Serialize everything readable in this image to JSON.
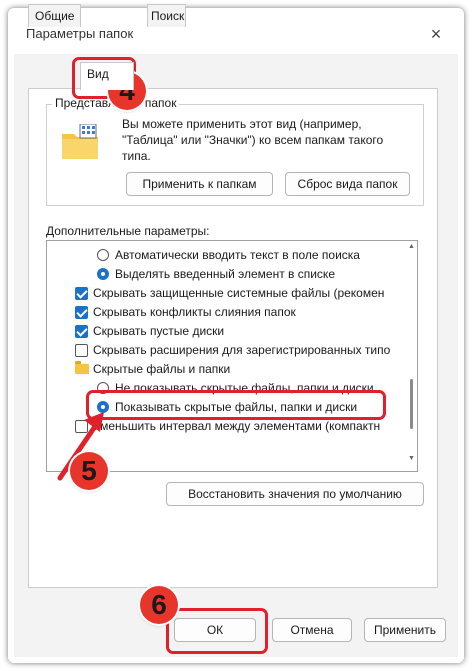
{
  "dialog": {
    "title": "Параметры папок",
    "close_label": "×"
  },
  "tabs": [
    {
      "label": "Общие"
    },
    {
      "label": "Вид"
    },
    {
      "label": "Поиск"
    }
  ],
  "folder_views": {
    "legend": "Представление папок",
    "description": "Вы можете применить этот вид (например, \"Таблица\" или \"Значки\") ко всем папкам такого типа.",
    "apply_button": "Применить к папкам",
    "reset_button": "Сброс вида папок"
  },
  "advanced": {
    "label": "Дополнительные параметры:",
    "items": [
      {
        "type": "radio",
        "checked": false,
        "indent": 1,
        "label": "Автоматически вводить текст в поле поиска"
      },
      {
        "type": "radio",
        "checked": true,
        "indent": 1,
        "label": "Выделять введенный элемент в списке"
      },
      {
        "type": "checkbox",
        "checked": true,
        "indent": 0,
        "label": "Скрывать защищенные системные файлы (рекомен"
      },
      {
        "type": "checkbox",
        "checked": true,
        "indent": 0,
        "label": "Скрывать конфликты слияния папок"
      },
      {
        "type": "checkbox",
        "checked": true,
        "indent": 0,
        "label": "Скрывать пустые диски"
      },
      {
        "type": "checkbox",
        "checked": false,
        "indent": 0,
        "label": "Скрывать расширения для зарегистрированных типо"
      },
      {
        "type": "folder",
        "checked": false,
        "indent": 0,
        "label": "Скрытые файлы и папки"
      },
      {
        "type": "radio",
        "checked": false,
        "indent": 1,
        "label": "Не показывать скрытые файлы, папки и диски"
      },
      {
        "type": "radio",
        "checked": true,
        "indent": 1,
        "label": "Показывать скрытые файлы, папки и диски"
      },
      {
        "type": "checkbox",
        "checked": false,
        "indent": 0,
        "label": "Уменьшить интервал между элементами (компактн"
      }
    ],
    "restore_button": "Восстановить значения по умолчанию"
  },
  "footer": {
    "ok_button": "ОК",
    "cancel_button": "Отмена",
    "apply_button": "Применить"
  },
  "callouts": {
    "step_4": "4",
    "step_5": "5",
    "step_6": "6",
    "color": "#e0202a"
  }
}
